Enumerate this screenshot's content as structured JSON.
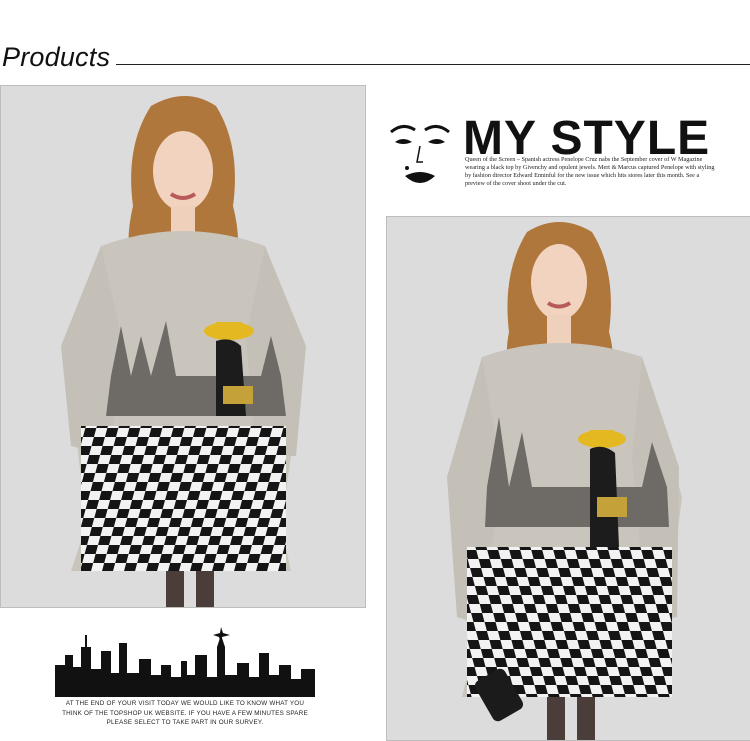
{
  "section": {
    "title": "Products"
  },
  "banner": {
    "headline": "MY STYLE",
    "blurb": "Queen of the Screen – Spanish actress Penelope Cruz nabs the September cover of W Magazine wearing a black top by Givenchy and opulent jewels. Mert & Marcus captured Penelope with styling by fashion director Edward Enninful for the new issue which hits stores later this month. See a preview of the cover shoot under the cut."
  },
  "footer": {
    "message": "AT THE END OF YOUR VISIT TODAY WE WOULD LIKE TO KNOW WHAT YOU THINK OF THE TOPSHOP UK WEBSITE. IF YOU HAVE A FEW MINUTES SPARE PLEASE SELECT TO TAKE PART IN OUR SURVEY."
  },
  "colors": {
    "background": "#ffffff",
    "photo_bg": "#dcdcdc",
    "sweater": "#c9c5bd",
    "accent_yellow": "#e4b820"
  },
  "icons": [
    "marilyn-face-icon",
    "city-skyline-icon"
  ]
}
